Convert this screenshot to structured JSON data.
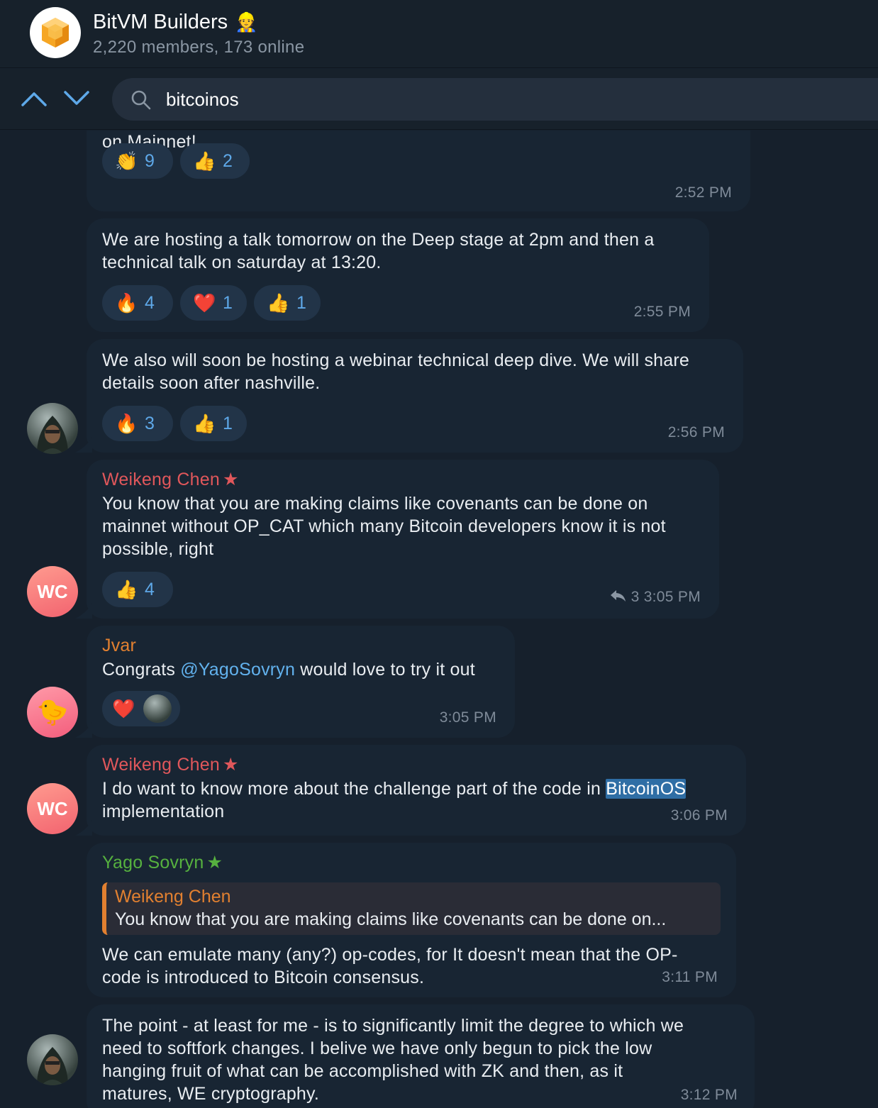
{
  "header": {
    "title": "BitVM Builders",
    "title_emoji": "👷",
    "subtitle": "2,220 members, 173 online"
  },
  "search": {
    "query": "bitcoinos"
  },
  "messages": [
    {
      "text_lines": [
        "on Mainnet!"
      ],
      "reactions": [
        {
          "emoji": "👏",
          "count": "9"
        },
        {
          "emoji": "👍",
          "count": "2"
        }
      ],
      "time": "2:52 PM"
    },
    {
      "text_lines": [
        "We are hosting a talk tomorrow on the Deep stage at 2pm and then a",
        "technical talk on saturday at 13:20."
      ],
      "reactions": [
        {
          "emoji": "🔥",
          "count": "4"
        },
        {
          "emoji": "❤️",
          "count": "1"
        },
        {
          "emoji": "👍",
          "count": "1"
        }
      ],
      "time": "2:55 PM"
    },
    {
      "text_lines": [
        "We also will soon be hosting a webinar technical deep dive. We will share",
        "details soon after nashville."
      ],
      "reactions": [
        {
          "emoji": "🔥",
          "count": "3"
        },
        {
          "emoji": "👍",
          "count": "1"
        }
      ],
      "time": "2:56 PM"
    },
    {
      "sender": "Weikeng Chen",
      "sender_badge": "★",
      "text_lines": [
        "You know that you are making claims like covenants can be done on",
        "mainnet without OP_CAT which many Bitcoin developers know it is not",
        "possible, right"
      ],
      "reactions": [
        {
          "emoji": "👍",
          "count": "4"
        }
      ],
      "replies": "3",
      "time": "3:05 PM",
      "avatar_initials": "WC"
    },
    {
      "sender": "Jvar",
      "text_before": "Congrats ",
      "mention": "@YagoSovryn",
      "text_after": " would love to try it out",
      "reactions": [
        {
          "emoji": "❤️"
        }
      ],
      "time": "3:05 PM",
      "avatar_emoji": "🐤"
    },
    {
      "sender": "Weikeng Chen",
      "sender_badge": "★",
      "text_before": "I do want to know more about the challenge part of the code in ",
      "match": "BitcoinOS",
      "text_line2": "implementation",
      "time": "3:06 PM",
      "avatar_initials": "WC"
    },
    {
      "sender": "Yago Sovryn",
      "sender_badge": "★",
      "quote": {
        "name": "Weikeng Chen",
        "text": "You know that you are making claims like covenants can be done on..."
      },
      "text_lines": [
        "We can emulate many (any?) op-codes, for It doesn't mean that the OP-",
        "code is introduced to Bitcoin consensus."
      ],
      "time": "3:11 PM"
    },
    {
      "text_lines": [
        "The point  - at least for me - is to significantly limit the degree to which we",
        "need to softfork changes. I belive we have only begun to pick the low",
        "hanging fruit of what can be accomplished with ZK and then, as it",
        "matures, WE cryptography."
      ],
      "time": "3:12 PM"
    }
  ],
  "colors": {
    "background": "#16202c",
    "bubble": "#182533",
    "accent_link": "#62b2ee",
    "sender_weikeng": "#e0575b",
    "sender_jvar": "#e28030",
    "sender_yago": "#56b13f"
  }
}
